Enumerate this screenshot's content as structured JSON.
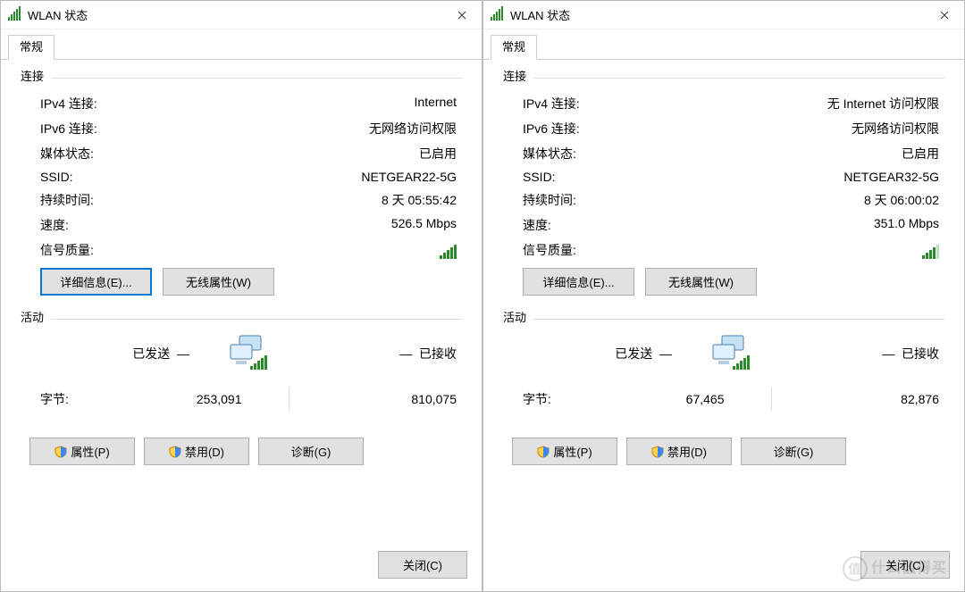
{
  "windows": [
    {
      "title": "WLAN 状态",
      "tab": "常规",
      "sections": {
        "connection_label": "连接",
        "activity_label": "活动"
      },
      "connection": {
        "ipv4_label": "IPv4 连接:",
        "ipv4_value": "Internet",
        "ipv6_label": "IPv6 连接:",
        "ipv6_value": "无网络访问权限",
        "media_label": "媒体状态:",
        "media_value": "已启用",
        "ssid_label": "SSID:",
        "ssid_value": "NETGEAR22-5G",
        "duration_label": "持续时间:",
        "duration_value": "8 天 05:55:42",
        "speed_label": "速度:",
        "speed_value": "526.5 Mbps",
        "signal_label": "信号质量:"
      },
      "buttons": {
        "details": "详细信息(E)...",
        "wireless_props": "无线属性(W)"
      },
      "activity": {
        "sent_label": "已发送",
        "recv_label": "已接收",
        "bytes_label": "字节:",
        "bytes_sent": "253,091",
        "bytes_recv": "810,075"
      },
      "bottom": {
        "properties": "属性(P)",
        "disable": "禁用(D)",
        "diagnose": "诊断(G)"
      },
      "footer": {
        "close": "关闭(C)"
      }
    },
    {
      "title": "WLAN 状态",
      "tab": "常规",
      "sections": {
        "connection_label": "连接",
        "activity_label": "活动"
      },
      "connection": {
        "ipv4_label": "IPv4 连接:",
        "ipv4_value": "无 Internet 访问权限",
        "ipv6_label": "IPv6 连接:",
        "ipv6_value": "无网络访问权限",
        "media_label": "媒体状态:",
        "media_value": "已启用",
        "ssid_label": "SSID:",
        "ssid_value": "NETGEAR32-5G",
        "duration_label": "持续时间:",
        "duration_value": "8 天 06:00:02",
        "speed_label": "速度:",
        "speed_value": "351.0 Mbps",
        "signal_label": "信号质量:"
      },
      "buttons": {
        "details": "详细信息(E)...",
        "wireless_props": "无线属性(W)"
      },
      "activity": {
        "sent_label": "已发送",
        "recv_label": "已接收",
        "bytes_label": "字节:",
        "bytes_sent": "67,465",
        "bytes_recv": "82,876"
      },
      "bottom": {
        "properties": "属性(P)",
        "disable": "禁用(D)",
        "diagnose": "诊断(G)"
      },
      "footer": {
        "close": "关闭(C)"
      }
    }
  ],
  "watermark": "什么值得买"
}
